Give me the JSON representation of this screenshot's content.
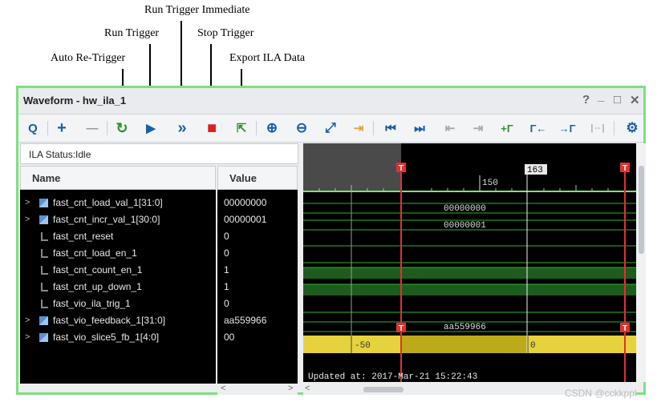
{
  "annotations": {
    "run_trigger_immediate": "Run Trigger Immediate",
    "run_trigger": "Run Trigger",
    "stop_trigger": "Stop Trigger",
    "auto_retrigger": "Auto Re-Trigger",
    "export_ila_data": "Export ILA Data"
  },
  "window": {
    "title": "Waveform - hw_ila_1",
    "help": "?",
    "minimize": "_",
    "maximize": "□",
    "close": "✕"
  },
  "toolbar": {
    "search": "Q",
    "add": "+",
    "remove": "—",
    "auto_retrigger": "↻",
    "run": "▶",
    "run_immediate": "»",
    "stop": "■",
    "export": "⇱",
    "zoom_in": "⊕",
    "zoom_out": "⊖",
    "zoom_fit": "⤢",
    "go_to_cursor": "⇥",
    "go_to_start": "⏮",
    "go_to_end": "⏭",
    "prev_transition": "⇤",
    "next_transition": "⇥",
    "add_marker": "+Γ",
    "prev_marker": "Γ←",
    "next_marker": "→Γ",
    "swap_cursors": "|⇔|",
    "settings": "⚙"
  },
  "status": "ILA Status:Idle",
  "columns": {
    "name": "Name",
    "value": "Value"
  },
  "signals": [
    {
      "name": "fast_cnt_load_val_1[31:0]",
      "value": "00000000",
      "type": "bus",
      "expandable": true
    },
    {
      "name": "fast_cnt_incr_val_1[30:0]",
      "value": "00000001",
      "type": "bus",
      "expandable": true
    },
    {
      "name": "fast_cnt_reset",
      "value": "0",
      "type": "bit",
      "expandable": false
    },
    {
      "name": "fast_cnt_load_en_1",
      "value": "0",
      "type": "bit",
      "expandable": false
    },
    {
      "name": "fast_cnt_count_en_1",
      "value": "1",
      "type": "bit",
      "expandable": false
    },
    {
      "name": "fast_cnt_up_down_1",
      "value": "1",
      "type": "bit",
      "expandable": false
    },
    {
      "name": "fast_vio_ila_trig_1",
      "value": "0",
      "type": "bit",
      "expandable": false
    },
    {
      "name": "fast_vio_feedback_1[31:0]",
      "value": "aa559966",
      "type": "bus",
      "expandable": true
    },
    {
      "name": "fast_vio_slice5_fb_1[4:0]",
      "value": "00",
      "type": "bus",
      "expandable": true
    }
  ],
  "waveform": {
    "cursor_label": "163",
    "ruler_tick": "150",
    "trigger_marker": "T",
    "bus_labels": [
      "00000000",
      "00000001",
      "aa559966"
    ],
    "slice_labels": [
      "-50",
      "0"
    ],
    "updated_text": "Updated at: 2017-Mar-21 15:22:43"
  },
  "scroll": {
    "left": "<",
    "right": ">"
  },
  "watermark": "CSDN @cckkppl",
  "colors": {
    "window_border": "#7ee07e",
    "trigger": "#e03030",
    "bit_high": "#1e5c1e",
    "bus_yellow": "#e6d23c"
  }
}
